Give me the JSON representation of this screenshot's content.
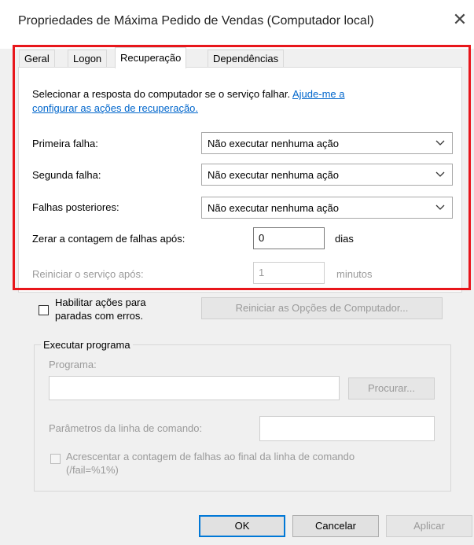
{
  "window": {
    "title": "Propriedades de Máxima Pedido de Vendas (Computador local)",
    "close_glyph": "✕"
  },
  "tabs": [
    {
      "label": "Geral",
      "active": false
    },
    {
      "label": "Logon",
      "active": false
    },
    {
      "label": "Recuperação",
      "active": true
    },
    {
      "label": "Dependências",
      "active": false
    }
  ],
  "recovery": {
    "description": "Selecionar a resposta do computador se o serviço falhar.",
    "help_link_line1": "Ajude-me a",
    "help_link_line2": "configurar as ações de recuperação.",
    "first_failure": {
      "label": "Primeira falha:",
      "value": "Não executar nenhuma ação"
    },
    "second_failure": {
      "label": "Segunda falha:",
      "value": "Não executar nenhuma ação"
    },
    "subsequent_failures": {
      "label": "Falhas posteriores:",
      "value": "Não executar nenhuma ação"
    },
    "reset_count": {
      "label": "Zerar a contagem de falhas após:",
      "value": "0",
      "unit": "dias"
    },
    "restart_service": {
      "label": "Reiniciar o serviço após:",
      "value": "1",
      "unit": "minutos"
    }
  },
  "stop_errors": {
    "checkbox_label_line1": "Habilitar ações para",
    "checkbox_label_line2": "paradas com erros.",
    "checked": false,
    "restart_options_button": "Reiniciar as Opções de Computador..."
  },
  "run_program": {
    "group_label": "Executar programa",
    "program_label": "Programa:",
    "program_value": "",
    "browse_button": "Procurar...",
    "params_label": "Parâmetros da linha de comando:",
    "params_value": "",
    "append_label_line1": "Acrescentar a contagem de falhas ao final da linha de comando",
    "append_label_line2": "(/fail=%1%)",
    "append_checked": false
  },
  "footer": {
    "ok": "OK",
    "cancel": "Cancelar",
    "apply": "Aplicar"
  },
  "colors": {
    "highlight_border": "#e8161b",
    "link": "#0066cc",
    "default_button_border": "#0078d7"
  }
}
